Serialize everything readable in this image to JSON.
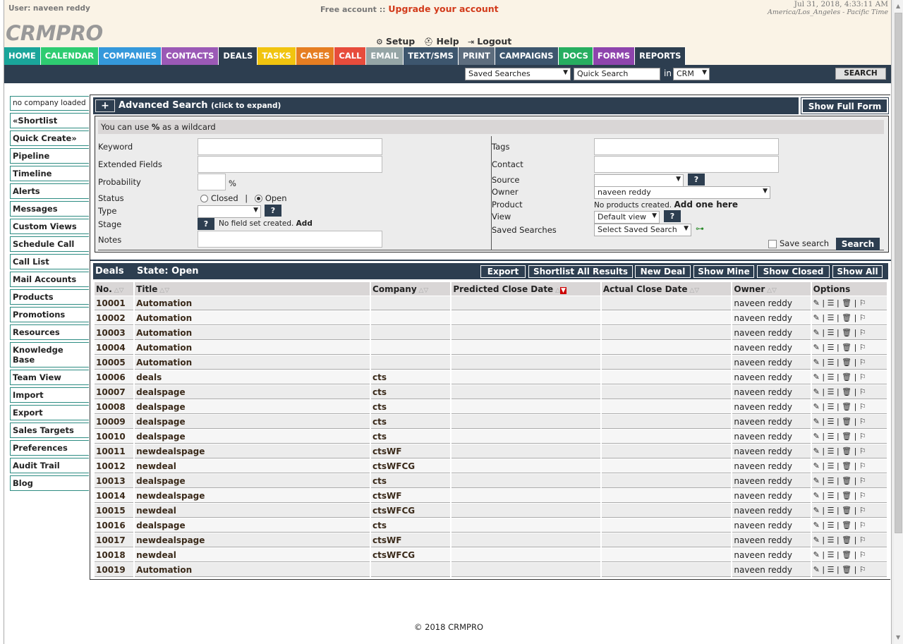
{
  "header": {
    "user_label": "User: naveen reddy",
    "free_account": "Free account ::",
    "upgrade_link": "Upgrade your account",
    "datetime": "Jul 31, 2018, 4:33:11 AM",
    "timezone": "America/Los_Angeles - Pacific Time",
    "logo": "CRMPRO",
    "setup": "Setup",
    "help": "Help",
    "logout": "Logout"
  },
  "nav": {
    "tabs": [
      {
        "label": "HOME",
        "color": "#1aa59a"
      },
      {
        "label": "CALENDAR",
        "color": "#2ecc71"
      },
      {
        "label": "COMPANIES",
        "color": "#3498db"
      },
      {
        "label": "CONTACTS",
        "color": "#9b59b6"
      },
      {
        "label": "DEALS",
        "color": "#2d3e50"
      },
      {
        "label": "TASKS",
        "color": "#f1c40f"
      },
      {
        "label": "CASES",
        "color": "#e67e22"
      },
      {
        "label": "CALL",
        "color": "#e74c3c"
      },
      {
        "label": "EMAIL",
        "color": "#95a5a6"
      },
      {
        "label": "TEXT/SMS",
        "color": "#3d566e"
      },
      {
        "label": "PRINT",
        "color": "#5d6d7e"
      },
      {
        "label": "CAMPAIGNS",
        "color": "#3d566e"
      },
      {
        "label": "DOCS",
        "color": "#27ae60"
      },
      {
        "label": "FORMS",
        "color": "#8e44ad"
      },
      {
        "label": "REPORTS",
        "color": "#2d3e50"
      }
    ]
  },
  "searchbar": {
    "saved_searches": "Saved Searches",
    "quick_search_placeholder": "Quick Search",
    "in_label": "in",
    "scope": "CRM",
    "search_button": "SEARCH"
  },
  "sidebar": {
    "company": "no company loaded",
    "items": [
      "«Shortlist",
      "Quick Create»",
      "Pipeline",
      "Timeline",
      "Alerts",
      "Messages",
      "Custom Views",
      "Schedule Call",
      "Call List",
      "Mail Accounts",
      "Products",
      "Promotions",
      "Resources",
      "Knowledge Base",
      "Team View",
      "Import",
      "Export",
      "Sales Targets",
      "Preferences",
      "Audit Trail",
      "Blog"
    ]
  },
  "advanced": {
    "plus": "+",
    "title": "Advanced Search",
    "hint": "(click to expand)",
    "full_form": "Show Full Form",
    "wildcard_pre": "You can use",
    "wildcard_sym": "%",
    "wildcard_post": "as a wildcard",
    "keyword": "Keyword",
    "extended": "Extended Fields",
    "probability": "Probability",
    "percent": "%",
    "status": "Status",
    "closed": "Closed",
    "pipe": "|",
    "open": "Open",
    "type": "Type",
    "stage": "Stage",
    "no_field_set": "No field set created.",
    "add": "Add",
    "notes": "Notes",
    "tags": "Tags",
    "contact": "Contact",
    "source": "Source",
    "owner": "Owner",
    "owner_value": "naveen reddy",
    "product": "Product",
    "no_products": "No products created.",
    "add_one": "Add one here",
    "view": "View",
    "view_value": "Default view",
    "saved_searches": "Saved Searches",
    "select_saved": "Select Saved Search",
    "save_search": "Save search",
    "search": "Search",
    "q": "?"
  },
  "deals": {
    "title": "Deals",
    "state": "State: Open",
    "buttons": [
      "Export",
      "Shortlist All Results",
      "New Deal",
      "Show Mine",
      "Show Closed",
      "Show All"
    ],
    "columns": [
      "No.",
      "Title",
      "Company",
      "Predicted Close Date",
      "Actual Close Date",
      "Owner",
      "Options"
    ],
    "options_glyphs": "✎ | ☰ | 🗑 | ⚐",
    "rows": [
      {
        "no": "10001",
        "title": "Automation",
        "company": "",
        "owner": "naveen reddy"
      },
      {
        "no": "10002",
        "title": "Automation",
        "company": "",
        "owner": "naveen reddy"
      },
      {
        "no": "10003",
        "title": "Automation",
        "company": "",
        "owner": "naveen reddy"
      },
      {
        "no": "10004",
        "title": "Automation",
        "company": "",
        "owner": "naveen reddy"
      },
      {
        "no": "10005",
        "title": "Automation",
        "company": "",
        "owner": "naveen reddy"
      },
      {
        "no": "10006",
        "title": "deals",
        "company": "cts",
        "owner": "naveen reddy"
      },
      {
        "no": "10007",
        "title": "dealspage",
        "company": "cts",
        "owner": "naveen reddy"
      },
      {
        "no": "10008",
        "title": "dealspage",
        "company": "cts",
        "owner": "naveen reddy"
      },
      {
        "no": "10009",
        "title": "dealspage",
        "company": "cts",
        "owner": "naveen reddy"
      },
      {
        "no": "10010",
        "title": "dealspage",
        "company": "cts",
        "owner": "naveen reddy"
      },
      {
        "no": "10011",
        "title": "newdealspage",
        "company": "ctsWF",
        "owner": "naveen reddy"
      },
      {
        "no": "10012",
        "title": "newdeal",
        "company": "ctsWFCG",
        "owner": "naveen reddy"
      },
      {
        "no": "10013",
        "title": "dealspage",
        "company": "cts",
        "owner": "naveen reddy"
      },
      {
        "no": "10014",
        "title": "newdealspage",
        "company": "ctsWF",
        "owner": "naveen reddy"
      },
      {
        "no": "10015",
        "title": "newdeal",
        "company": "ctsWFCG",
        "owner": "naveen reddy"
      },
      {
        "no": "10016",
        "title": "dealspage",
        "company": "cts",
        "owner": "naveen reddy"
      },
      {
        "no": "10017",
        "title": "newdealspage",
        "company": "ctsWF",
        "owner": "naveen reddy"
      },
      {
        "no": "10018",
        "title": "newdeal",
        "company": "ctsWFCG",
        "owner": "naveen reddy"
      },
      {
        "no": "10019",
        "title": "Automation",
        "company": "",
        "owner": "naveen reddy"
      }
    ]
  },
  "footer": "© 2018 CRMPRO"
}
